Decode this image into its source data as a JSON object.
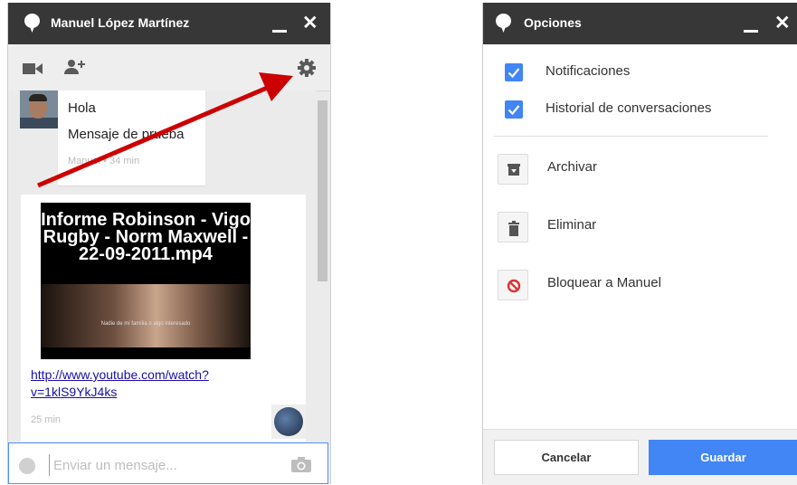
{
  "chat": {
    "title": "Manuel López Martínez",
    "messages": [
      {
        "lines": [
          "Hola",
          "Mensaje de prueba"
        ],
        "meta": "Manuel • 34 min"
      }
    ],
    "video": {
      "title": "Informe Robinson - Vigo Rugby - Norm Maxwell - 22-09-2011.mp4",
      "caption": "Nadie de mi familia o algo interesado",
      "link": "http://www.youtube.com/watch?v=1klS9YkJ4ks",
      "meta": "25 min"
    },
    "input_placeholder": "Enviar un mensaje...",
    "icons": {
      "video": "video-camera-icon",
      "add_person": "add-person-icon",
      "settings": "gear-icon",
      "emoji": "smiley-icon",
      "photo": "camera-icon"
    }
  },
  "options": {
    "title": "Opciones",
    "checkboxes": [
      {
        "label": "Notificaciones",
        "checked": true
      },
      {
        "label": "Historial de conversaciones",
        "checked": true
      }
    ],
    "actions": [
      {
        "label": "Archivar",
        "icon": "archive-icon"
      },
      {
        "label": "Eliminar",
        "icon": "trash-icon"
      },
      {
        "label": "Bloquear a Manuel",
        "icon": "block-icon"
      }
    ],
    "cancel_label": "Cancelar",
    "save_label": "Guardar"
  },
  "colors": {
    "titlebar": "#373737",
    "accent": "#4285f4",
    "arrow": "#cc0000",
    "block_icon": "#dd3333"
  }
}
